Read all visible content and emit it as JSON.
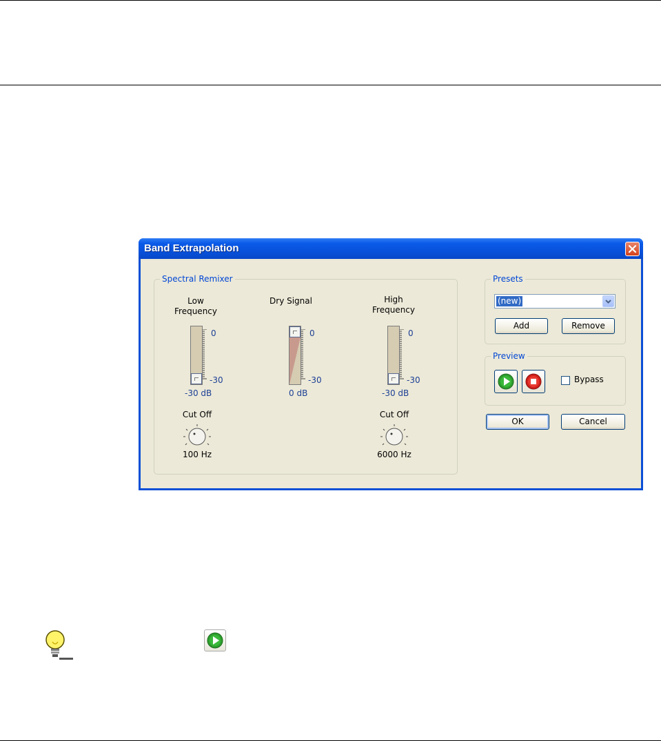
{
  "dialog": {
    "title": "Band Extrapolation",
    "spectral_remixer": {
      "legend": "Spectral Remixer",
      "low_frequency": {
        "label_line1": "Low",
        "label_line2": "Frequency",
        "scale_top": "0",
        "scale_bottom": "-30",
        "value": "-30 dB",
        "cutoff_label": "Cut Off",
        "cutoff_value": "100 Hz"
      },
      "dry_signal": {
        "label": "Dry Signal",
        "scale_top": "0",
        "scale_bottom": "-30",
        "value": "0 dB"
      },
      "high_frequency": {
        "label_line1": "High",
        "label_line2": "Frequency",
        "scale_top": "0",
        "scale_bottom": "-30",
        "value": "-30 dB",
        "cutoff_label": "Cut Off",
        "cutoff_value": "6000 Hz"
      }
    },
    "presets": {
      "legend": "Presets",
      "selected": "(new)",
      "add_label": "Add",
      "remove_label": "Remove"
    },
    "preview": {
      "legend": "Preview",
      "bypass_label": "Bypass",
      "bypass_checked": false
    },
    "ok_label": "OK",
    "cancel_label": "Cancel"
  },
  "colors": {
    "titlebar": "#0a5ae8",
    "legend_text": "#0046d5",
    "play_green": "#2e9e2e",
    "stop_red": "#d0201a"
  },
  "icons": {
    "tip": "lightbulb-icon",
    "play": "play-icon",
    "stop": "stop-icon",
    "close": "close-icon"
  }
}
